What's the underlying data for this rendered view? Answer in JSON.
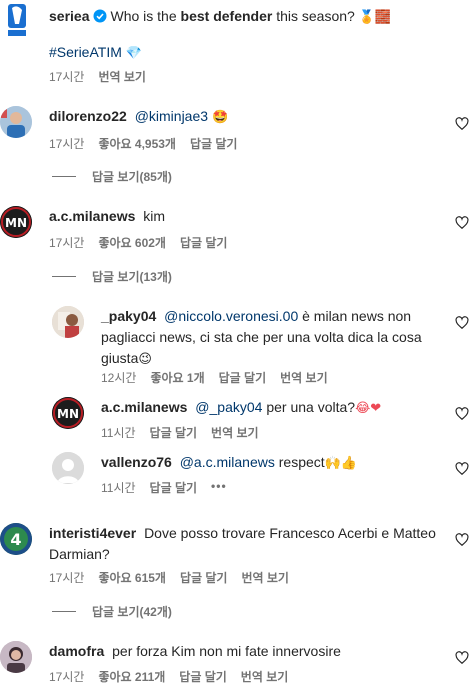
{
  "comments": [
    {
      "user": "seriea",
      "text_pre": "Who is the ",
      "text_bold": "best defender",
      "text_post": " this season? ",
      "emoji": "🏅🧱",
      "hashtag": "#SerieATIM",
      "hashtag_emoji": "💎",
      "time": "17시간",
      "translate": "번역 보기"
    },
    {
      "user": "dilorenzo22",
      "mention": "@kiminjae3",
      "emoji": "🤩",
      "time": "17시간",
      "likes": "좋아요 4,953개",
      "reply": "답글 달기",
      "view_replies": "답글 보기(85개)"
    },
    {
      "user": "a.c.milanews",
      "text": "kim",
      "time": "17시간",
      "likes": "좋아요 602개",
      "reply": "답글 달기",
      "view_replies": "답글 보기(13개)"
    },
    {
      "user": "_paky04",
      "mention": "@niccolo.veronesi.00",
      "text_line1": " è milan news non",
      "text_line2": "pagliacci news, ci sta che per una volta dica la cosa",
      "text_line3": "giusta",
      "emoji": "😉",
      "time": "12시간",
      "likes": "좋아요 1개",
      "reply": "답글 달기",
      "translate": "번역 보기"
    },
    {
      "user": "a.c.milanews",
      "mention": "@_paky04",
      "text": " per una volta?",
      "emoji": "😂❤",
      "time": "11시간",
      "reply": "답글 달기",
      "translate": "번역 보기"
    },
    {
      "user": "vallenzo76",
      "mention": "@a.c.milanews",
      "text": " respect",
      "emoji": "🙌👍",
      "time": "11시간",
      "reply": "답글 달기",
      "more": "•••"
    },
    {
      "user": "interisti4ever",
      "text_line1": "Dove posso trovare Francesco Acerbi e Matteo",
      "text_line2": "Darmian?",
      "time": "17시간",
      "likes": "좋아요 615개",
      "reply": "답글 달기",
      "translate": "번역 보기",
      "view_replies": "답글 보기(42개)"
    },
    {
      "user": "damofra",
      "text": "per forza Kim non mi fate innervosire",
      "time": "17시간",
      "likes": "좋아요 211개",
      "reply": "답글 달기",
      "translate": "번역 보기"
    }
  ],
  "colors": {
    "meta": "#737373",
    "link": "#00376b",
    "text": "#262626",
    "verified": "#0095f6",
    "heart_red": "#ed4956"
  }
}
